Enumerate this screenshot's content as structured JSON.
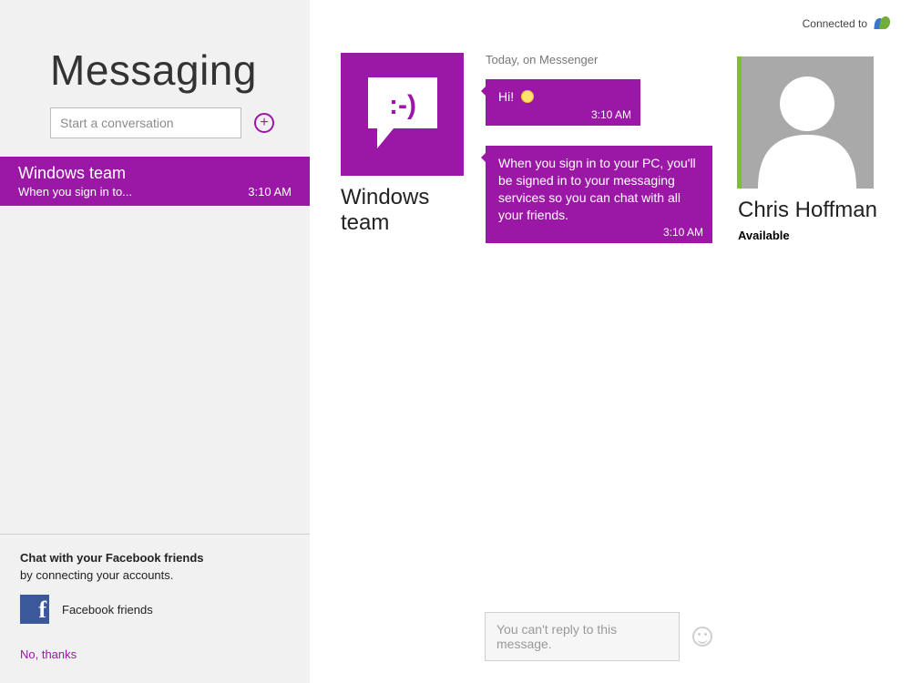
{
  "header": {
    "app_title": "Messaging",
    "connected_label": "Connected to"
  },
  "start": {
    "placeholder": "Start a conversation"
  },
  "conversations": [
    {
      "name": "Windows team",
      "preview": "When you sign in to...",
      "time": "3:10 AM"
    }
  ],
  "fb_prompt": {
    "line1": "Chat with your Facebook friends",
    "line2": "by connecting your accounts.",
    "item_label": "Facebook friends",
    "no_thanks": "No, thanks"
  },
  "sender": {
    "name": "Windows\nteam"
  },
  "thread": {
    "day_header": "Today, on Messenger",
    "messages": [
      {
        "text": "Hi!",
        "time": "3:10 AM",
        "has_emoji": true
      },
      {
        "text": "When you sign in to your PC, you'll be signed in to your messaging services so you can chat with all your friends.",
        "time": "3:10 AM",
        "has_emoji": false
      }
    ],
    "reply_placeholder": "You can't reply to this message."
  },
  "me": {
    "name": "Chris Hoffman",
    "status": "Available"
  },
  "colors": {
    "accent": "#9b17a6",
    "presence": "#7fbf2d"
  }
}
